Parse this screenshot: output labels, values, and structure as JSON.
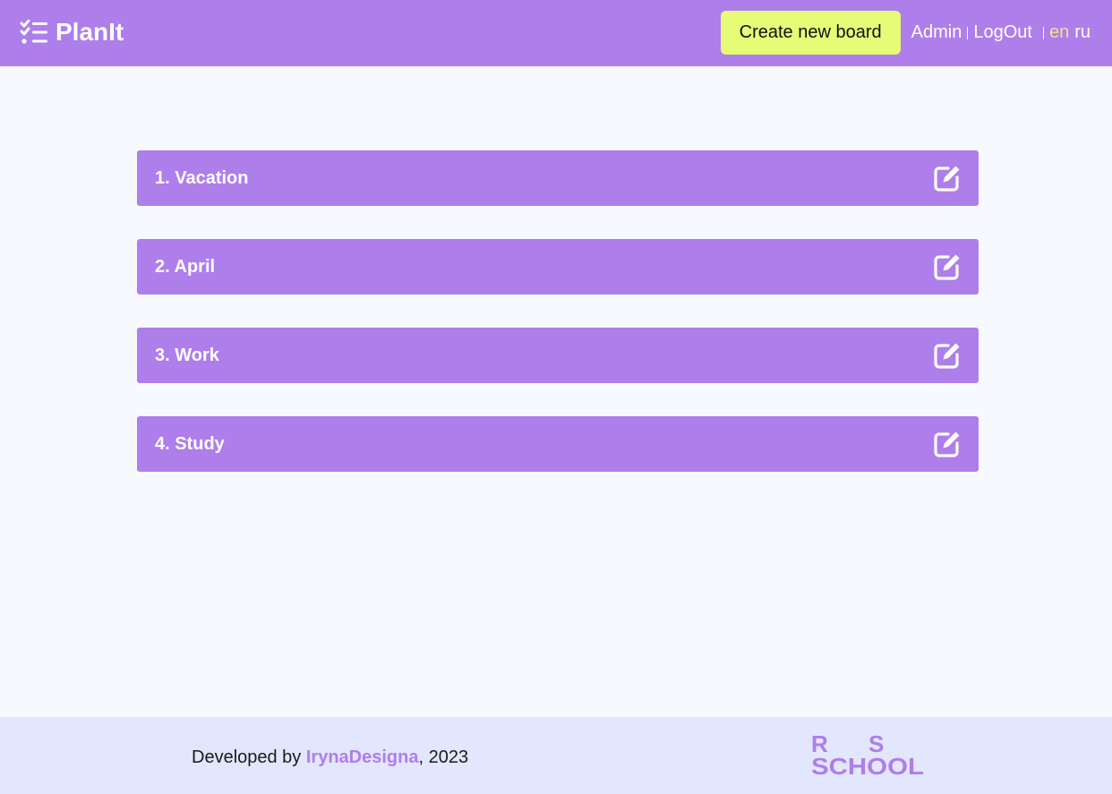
{
  "header": {
    "app_name": "PlanIt",
    "logo_icon": "checklist-icon",
    "create_board_label": "Create new board",
    "admin_label": "Admin",
    "logout_label": "LogOut",
    "languages": [
      "en",
      "ru"
    ],
    "active_language": "en"
  },
  "boards": [
    {
      "title": "1. Vacation",
      "icon": "edit-icon"
    },
    {
      "title": "2. April",
      "icon": "edit-icon"
    },
    {
      "title": "3. Work",
      "icon": "edit-icon"
    },
    {
      "title": "4. Study",
      "icon": "edit-icon"
    }
  ],
  "footer": {
    "developed_by": "Developed by ",
    "author": "IrynaDesigna",
    "year_suffix": ", 2023",
    "school_logo": {
      "top": "R S",
      "bottom": "SCHOOL"
    }
  },
  "colors": {
    "accent": "#ae7eeb",
    "button": "#e6fb76",
    "active_language": "#f4e08a",
    "footer_bg": "#e3e7fd",
    "page_bg": "#f8f9fe"
  }
}
